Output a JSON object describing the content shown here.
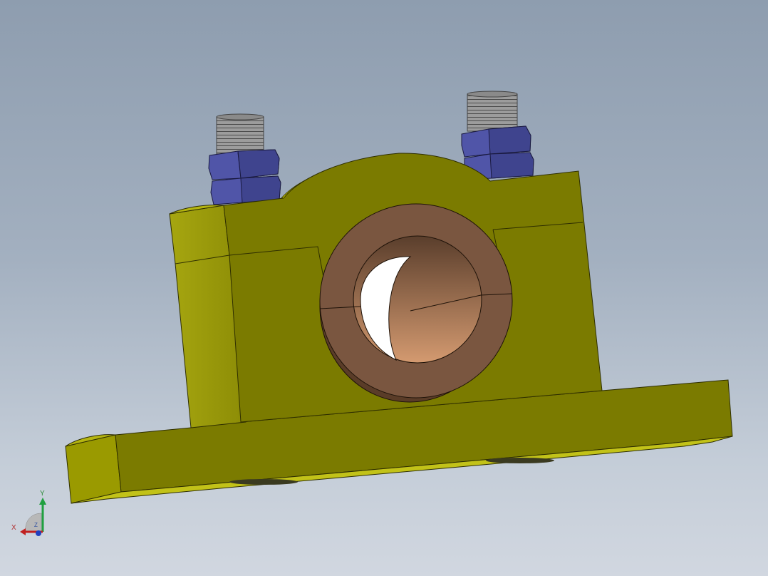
{
  "viewport": {
    "background_top": "#8e9daf",
    "background_bottom": "#d1d7e0"
  },
  "model": {
    "name": "pillow-block-bearing-assembly",
    "colors": {
      "housing_face": "#7b7b00",
      "housing_side": "#9a9a08",
      "housing_top": "#b9b91a",
      "bearing_face": "#7a5640",
      "bearing_inner": "#c08a64",
      "nut": "#4a4fa0",
      "thread": "#8a8a8a"
    },
    "icons": [
      "stud-bolt-icon",
      "hex-nut-icon",
      "bearing-bushing-icon"
    ]
  },
  "triad": {
    "x_label": "X",
    "y_label": "Y",
    "z_label": "Z",
    "x_color": "#c02020",
    "y_color": "#20a040",
    "z_color": "#2040c0"
  }
}
